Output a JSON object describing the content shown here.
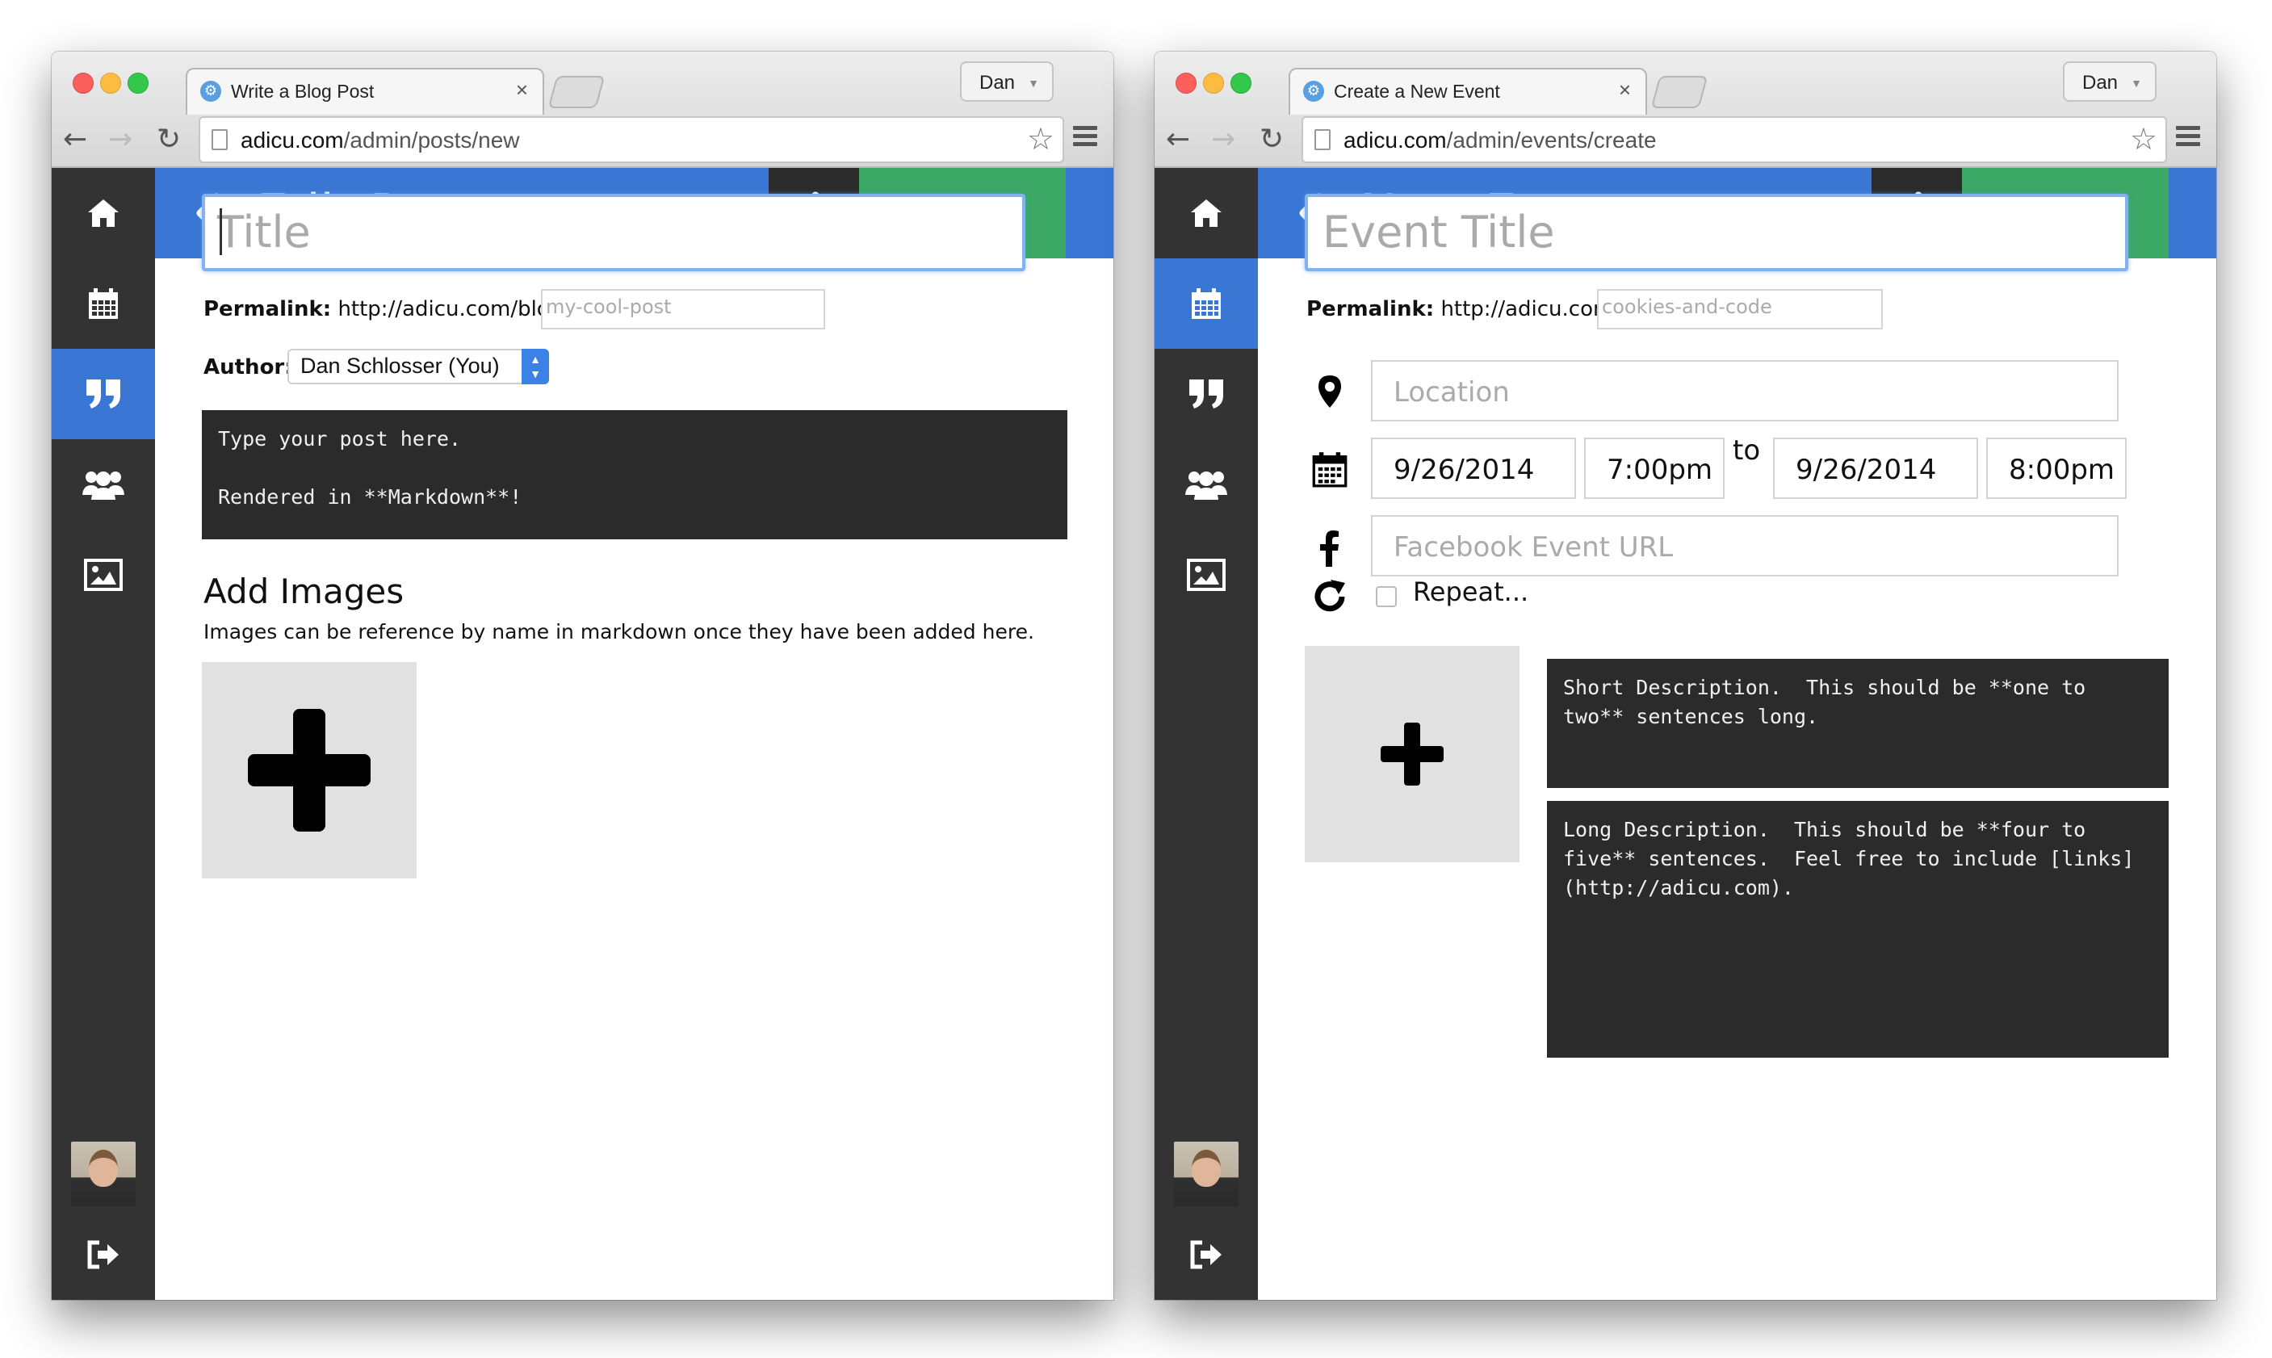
{
  "left_window": {
    "tab_title": "Write a Blog Post",
    "tab_close": "×",
    "profile": "Dan",
    "url_host": "adicu.com",
    "url_path": "/admin/posts/new",
    "header": {
      "title": "Edit Post",
      "save_draft": "Save Draft",
      "publish": "Publish"
    },
    "title_placeholder": "Title",
    "permalink_label": "Permalink:",
    "permalink_base": "http://adicu.com/blog/post/",
    "permalink_slug_placeholder": "my-cool-post",
    "author_label": "Author:",
    "author_value": "Dan Schlosser (You)",
    "post_body": "Type your post here.\n\nRendered in **Markdown**!",
    "add_images_heading": "Add Images",
    "add_images_hint": "Images can be reference by name in markdown once they have been added here.",
    "active_sidebar_item": "quotes"
  },
  "right_window": {
    "tab_title": "Create a New Event",
    "tab_close": "×",
    "profile": "Dan",
    "url_host": "adicu.com",
    "url_path": "/admin/events/create",
    "header": {
      "title": "New Event",
      "save_draft": "Save Draft",
      "publish": "Publish"
    },
    "title_placeholder": "Event Title",
    "permalink_label": "Permalink:",
    "permalink_base": "http://adicu.com/events/",
    "permalink_slug_placeholder": "cookies-and-code",
    "location_placeholder": "Location",
    "start_date": "9/26/2014",
    "start_time": "7:00pm",
    "to_label": "to",
    "end_date": "9/26/2014",
    "end_time": "8:00pm",
    "facebook_placeholder": "Facebook Event URL",
    "repeat_label": "Repeat...",
    "short_description": "Short Description.  This should be **one to two** sentences long.",
    "long_description": "Long Description.  This should be **four to five** sentences.  Feel free to include [links](http://adicu.com).",
    "active_sidebar_item": "calendar"
  },
  "sidebar_items": [
    "home-icon",
    "calendar-icon",
    "quote-icon",
    "users-icon",
    "image-icon"
  ],
  "colors": {
    "header_blue": "#3a77d4",
    "publish_green": "#3ba865",
    "sidebar_dark": "#333333",
    "editor_dark": "#2b2b2b"
  }
}
